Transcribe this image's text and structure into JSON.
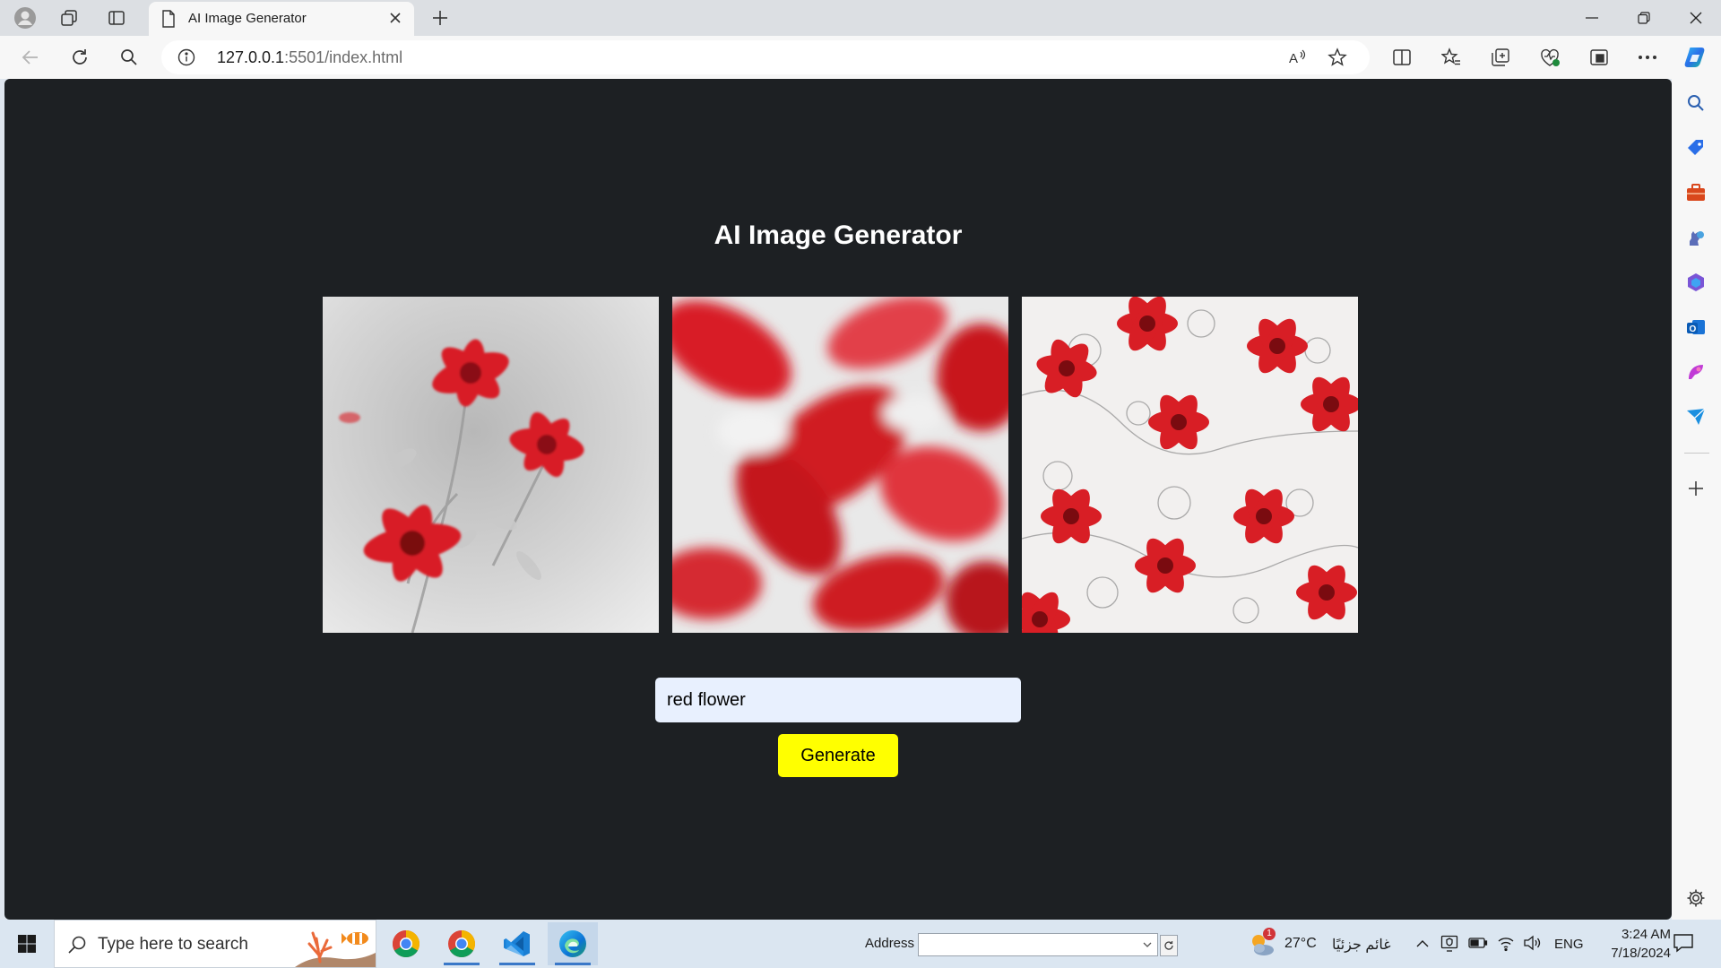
{
  "browser": {
    "tab_title": "AI Image Generator",
    "url_host": "127.0.0.1",
    "url_rest": ":5501/index.html"
  },
  "page": {
    "title": "AI Image Generator",
    "prompt_value": "red flower",
    "generate_label": "Generate",
    "images": [
      {
        "name": "generated-image-1"
      },
      {
        "name": "generated-image-2"
      },
      {
        "name": "generated-image-3"
      }
    ]
  },
  "taskbar": {
    "search_placeholder": "Type here to search",
    "address_label": "Address",
    "weather_temp": "27°C",
    "weather_badge": "1",
    "weather_desc": "غائم جزئيًا",
    "language": "ENG",
    "time": "3:24 AM",
    "date": "7/18/2024"
  },
  "colors": {
    "page_background": "#1d2023",
    "generate_button": "#ffff00",
    "input_background": "#e8f0fe"
  }
}
